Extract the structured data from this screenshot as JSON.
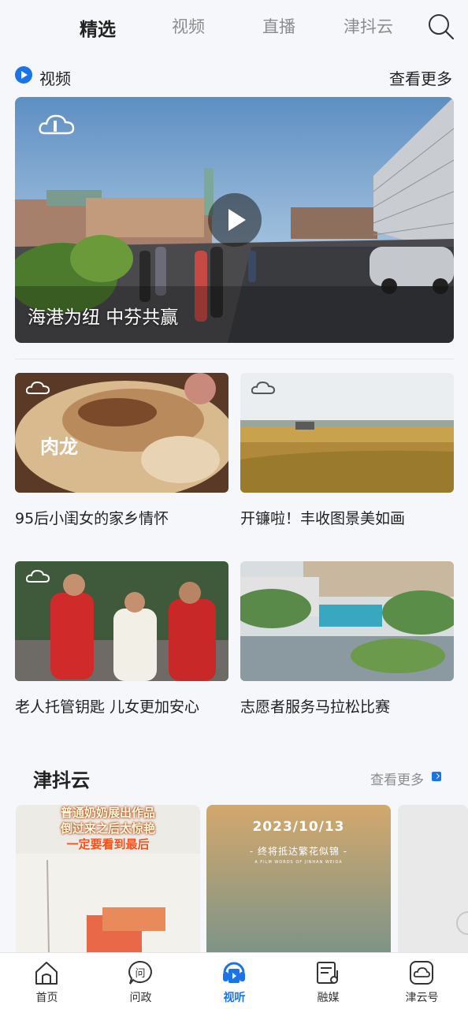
{
  "top_tabs": [
    {
      "label": "精选",
      "active": true
    },
    {
      "label": "视频",
      "active": false
    },
    {
      "label": "直播",
      "active": false
    },
    {
      "label": "津抖云",
      "active": false
    }
  ],
  "video_section": {
    "title": "视频",
    "more": "查看更多",
    "hero_caption": "海港为纽 中芬共赢",
    "items": [
      {
        "title": "95后小闺女的家乡情怀",
        "overlay_text": "肉龙"
      },
      {
        "title": "开镰啦！丰收图景美如画"
      },
      {
        "title": "老人托管钥匙 儿女更加安心"
      },
      {
        "title": "志愿者服务马拉松比赛"
      }
    ]
  },
  "jindouyun": {
    "title": "津抖云",
    "more": "查看更多",
    "reels": [
      {
        "banner_line1": "普通奶奶展出作品",
        "banner_line2": "倒过来之后太惊艳",
        "banner_line3": "一定要看到最后"
      },
      {
        "date": "2023/10/13",
        "subtitle": "- 终将抵达繁花似锦 -",
        "subtitle_en": "A FILM WORDS OF JINHAN WEIDA"
      }
    ]
  },
  "bottom_nav": [
    {
      "label": "首页",
      "icon": "home-icon",
      "active": false
    },
    {
      "label": "问政",
      "icon": "ask-icon",
      "active": false
    },
    {
      "label": "视听",
      "icon": "tv-icon",
      "active": true
    },
    {
      "label": "融媒",
      "icon": "media-icon",
      "active": false
    },
    {
      "label": "津云号",
      "icon": "cloud-icon",
      "active": false
    }
  ],
  "colors": {
    "accent": "#1a73e8",
    "background": "#f5f7fb"
  }
}
